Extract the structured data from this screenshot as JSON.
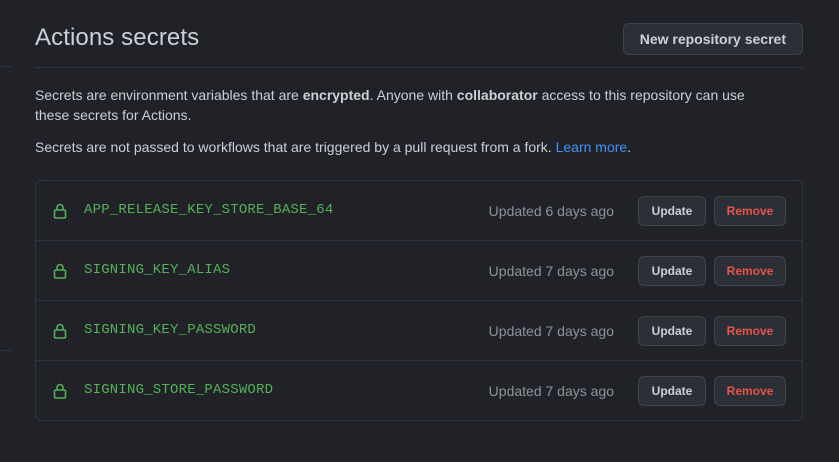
{
  "header": {
    "title": "Actions secrets",
    "new_secret_label": "New repository secret"
  },
  "description": {
    "line1_a": "Secrets are environment variables that are ",
    "line1_b": "encrypted",
    "line1_c": ". Anyone with ",
    "line1_d": "collaborator",
    "line1_e": " access to this repository can use these secrets for Actions.",
    "line2": "Secrets are not passed to workflows that are triggered by a pull request from a fork. ",
    "learn_more": "Learn more",
    "period": "."
  },
  "secrets": [
    {
      "name": "APP_RELEASE_KEY_STORE_BASE_64",
      "updated": "Updated 6 days ago",
      "update_label": "Update",
      "remove_label": "Remove",
      "icon": "lock-icon"
    },
    {
      "name": "SIGNING_KEY_ALIAS",
      "updated": "Updated 7 days ago",
      "update_label": "Update",
      "remove_label": "Remove",
      "icon": "lock-icon"
    },
    {
      "name": "SIGNING_KEY_PASSWORD",
      "updated": "Updated 7 days ago",
      "update_label": "Update",
      "remove_label": "Remove",
      "icon": "lock-icon"
    },
    {
      "name": "SIGNING_STORE_PASSWORD",
      "updated": "Updated 7 days ago",
      "update_label": "Update",
      "remove_label": "Remove",
      "icon": "lock-icon"
    }
  ],
  "colors": {
    "background": "#202227",
    "secret_name": "#56b05a",
    "link": "#4493f8",
    "danger": "#e5534b"
  }
}
